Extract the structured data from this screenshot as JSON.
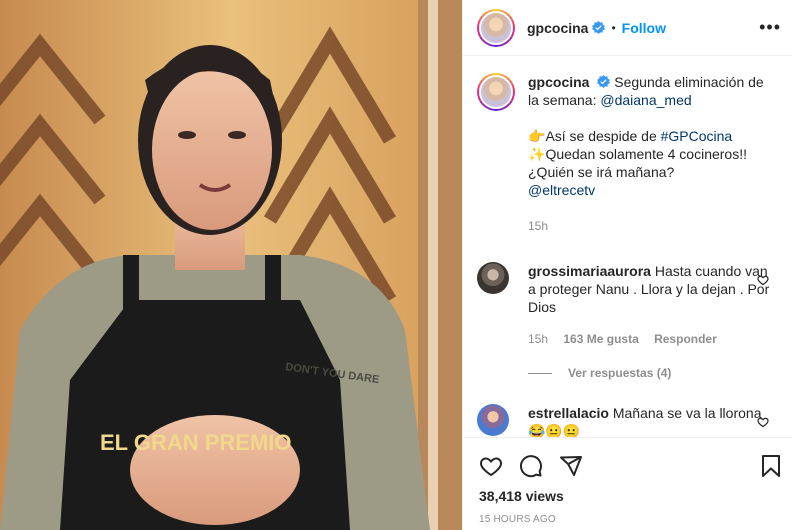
{
  "post": {
    "username": "gpcocina",
    "follow_label": "Follow",
    "dot": "•",
    "more_label": "•••"
  },
  "caption": {
    "username": "gpcocina",
    "line1": "Segunda eliminación de la semana: ",
    "mention": "@daiana_med",
    "emoji1": "👉",
    "line2": "Así se despide de ",
    "hashtag": "#GPCocina",
    "emoji2": "✨",
    "line3": "Quedan solamente 4 cocineros!!",
    "line4": "¿Quién se irá mañana?",
    "mention2": "@eltrecetv",
    "time": "15h"
  },
  "comments": [
    {
      "username": "grossimariaaurora",
      "text": "Hasta cuando van a proteger Nanu . Llora y la dejan . Por Dios",
      "time": "15h",
      "likes": "163 Me gusta",
      "reply_label": "Responder",
      "view_replies": "Ver respuestas (4)"
    },
    {
      "username": "estrellalacio",
      "text": "Mañana se va la llorona 😂😐😐"
    }
  ],
  "footer": {
    "views": "38,418 views",
    "ago": "15 HOURS AGO"
  },
  "video_overlay": {
    "apron_text_1": "EL GRAN PREMIO",
    "shirt_text": "DON'T YOU DARE"
  },
  "colors": {
    "accent_blue": "#0095f6",
    "link_blue": "#00376b",
    "secondary_gray": "#8e8e8e"
  }
}
